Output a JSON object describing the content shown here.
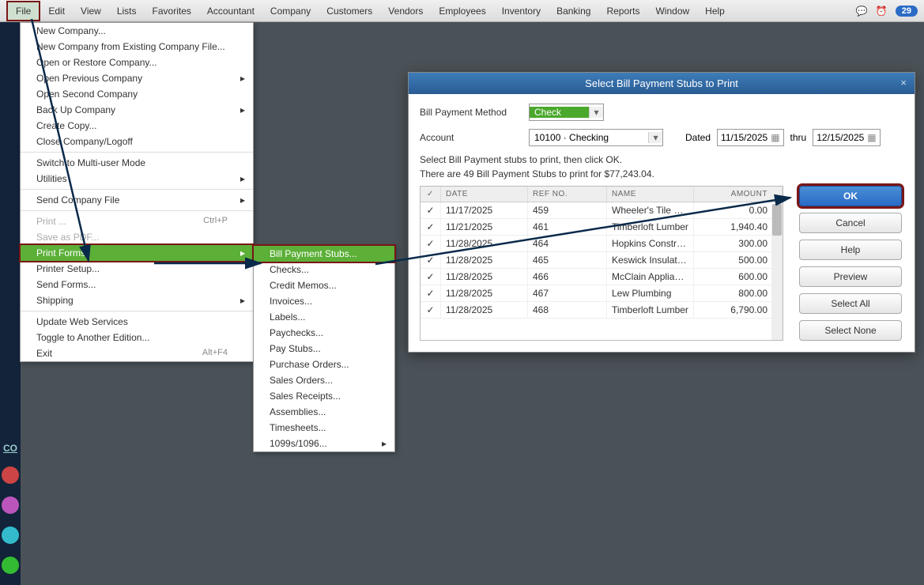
{
  "menubar": {
    "items": [
      "File",
      "Edit",
      "View",
      "Lists",
      "Favorites",
      "Accountant",
      "Company",
      "Customers",
      "Vendors",
      "Employees",
      "Inventory",
      "Banking",
      "Reports",
      "Window",
      "Help"
    ],
    "badge": "29"
  },
  "file_menu": {
    "items": [
      {
        "label": "New Company..."
      },
      {
        "label": "New Company from Existing Company File..."
      },
      {
        "label": "Open or Restore Company..."
      },
      {
        "label": "Open Previous Company",
        "arrow": true
      },
      {
        "label": "Open Second Company"
      },
      {
        "label": "Back Up Company",
        "arrow": true
      },
      {
        "label": "Create Copy..."
      },
      {
        "label": "Close Company/Logoff"
      },
      {
        "sep": true
      },
      {
        "label": "Switch to Multi-user Mode"
      },
      {
        "label": "Utilities",
        "arrow": true
      },
      {
        "sep": true
      },
      {
        "label": "Send Company File",
        "arrow": true
      },
      {
        "sep": true
      },
      {
        "label": "Print ...",
        "shortcut": "Ctrl+P",
        "disabled": true
      },
      {
        "label": "Save as PDF...",
        "disabled": true
      },
      {
        "label": "Print Forms",
        "arrow": true,
        "selected": true
      },
      {
        "label": "Printer Setup..."
      },
      {
        "label": "Send Forms..."
      },
      {
        "label": "Shipping",
        "arrow": true
      },
      {
        "sep": true
      },
      {
        "label": "Update Web Services"
      },
      {
        "label": "Toggle to Another Edition..."
      },
      {
        "label": "Exit",
        "shortcut": "Alt+F4"
      }
    ]
  },
  "submenu": {
    "items": [
      {
        "label": "Bill Payment Stubs...",
        "selected": true
      },
      {
        "label": "Checks..."
      },
      {
        "label": "Credit Memos..."
      },
      {
        "label": "Invoices..."
      },
      {
        "label": "Labels..."
      },
      {
        "label": "Paychecks..."
      },
      {
        "label": "Pay Stubs..."
      },
      {
        "label": "Purchase Orders..."
      },
      {
        "label": "Sales Orders..."
      },
      {
        "label": "Sales Receipts..."
      },
      {
        "label": "Assemblies..."
      },
      {
        "label": "Timesheets..."
      },
      {
        "label": "1099s/1096...",
        "arrow": true
      }
    ]
  },
  "dialog": {
    "title": "Select Bill Payment Stubs to Print",
    "payment_method_label": "Bill Payment Method",
    "payment_method_value": "Check",
    "account_label": "Account",
    "account_value": "10100 · Checking",
    "dated_label": "Dated",
    "date_from": "11/15/2025",
    "thru_label": "thru",
    "date_to": "12/15/2025",
    "instruction1": "Select Bill Payment stubs to print, then click OK.",
    "instruction2": "There are 49 Bill Payment Stubs to print for $77,243.04.",
    "headers": {
      "check": "✓",
      "date": "DATE",
      "ref": "REF NO.",
      "name": "NAME",
      "amount": "AMOUNT"
    },
    "rows": [
      {
        "date": "11/17/2025",
        "ref": "459",
        "name": "Wheeler's Tile Etc.",
        "amount": "0.00"
      },
      {
        "date": "11/21/2025",
        "ref": "461",
        "name": "Timberloft Lumber",
        "amount": "1,940.40"
      },
      {
        "date": "11/28/2025",
        "ref": "464",
        "name": "Hopkins Constru...",
        "amount": "300.00"
      },
      {
        "date": "11/28/2025",
        "ref": "465",
        "name": "Keswick Insulation",
        "amount": "500.00"
      },
      {
        "date": "11/28/2025",
        "ref": "466",
        "name": "McClain Applianc...",
        "amount": "600.00"
      },
      {
        "date": "11/28/2025",
        "ref": "467",
        "name": "Lew Plumbing",
        "amount": "800.00"
      },
      {
        "date": "11/28/2025",
        "ref": "468",
        "name": "Timberloft Lumber",
        "amount": "6,790.00"
      }
    ],
    "buttons": {
      "ok": "OK",
      "cancel": "Cancel",
      "help": "Help",
      "preview": "Preview",
      "select_all": "Select All",
      "select_none": "Select None"
    }
  },
  "dock": {
    "co": "CO"
  }
}
